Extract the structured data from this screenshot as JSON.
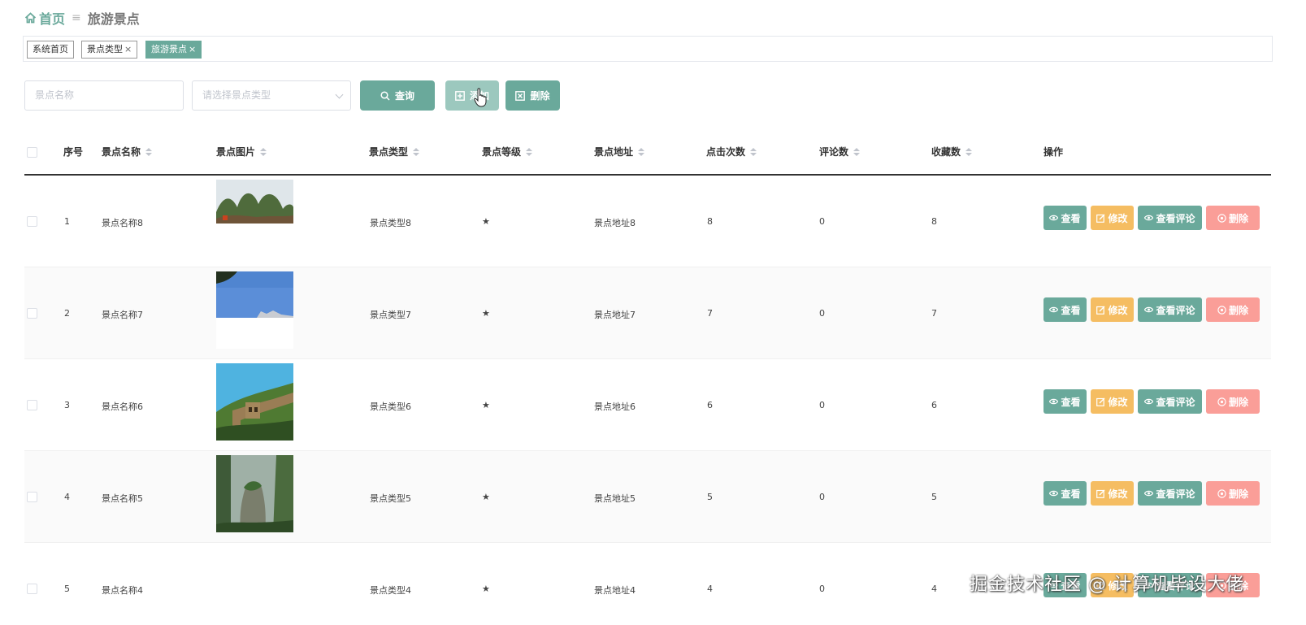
{
  "breadcrumb": {
    "home": "首页",
    "separator": "≡",
    "current": "旅游景点"
  },
  "tabs": [
    {
      "label": "系统首页",
      "closable": false,
      "active": false
    },
    {
      "label": "景点类型",
      "closable": true,
      "active": false
    },
    {
      "label": "旅游景点",
      "closable": true,
      "active": true
    }
  ],
  "search": {
    "name_placeholder": "景点名称",
    "type_placeholder": "请选择景点类型",
    "query_label": "查询",
    "add_label": "添加",
    "delete_label": "删除"
  },
  "table": {
    "columns": [
      "序号",
      "景点名称",
      "景点图片",
      "景点类型",
      "景点等级",
      "景点地址",
      "点击次数",
      "评论数",
      "收藏数",
      "操作"
    ],
    "rows": [
      {
        "index": "1",
        "name": "景点名称8",
        "image": "karst-mountains",
        "type": "景点类型8",
        "level": "★",
        "address": "景点地址8",
        "clicks": "8",
        "comments": "0",
        "favorites": "8"
      },
      {
        "index": "2",
        "name": "景点名称7",
        "image": "blue-sky",
        "type": "景点类型7",
        "level": "★",
        "address": "景点地址7",
        "clicks": "7",
        "comments": "0",
        "favorites": "7"
      },
      {
        "index": "3",
        "name": "景点名称6",
        "image": "great-wall",
        "type": "景点类型6",
        "level": "★",
        "address": "景点地址6",
        "clicks": "6",
        "comments": "0",
        "favorites": "6"
      },
      {
        "index": "4",
        "name": "景点名称5",
        "image": "stone-pillars",
        "type": "景点类型5",
        "level": "★",
        "address": "景点地址5",
        "clicks": "5",
        "comments": "0",
        "favorites": "5"
      },
      {
        "index": "5",
        "name": "景点名称4",
        "image": "none",
        "type": "景点类型4",
        "level": "★",
        "address": "景点地址4",
        "clicks": "4",
        "comments": "0",
        "favorites": "4"
      }
    ],
    "row_actions": {
      "view": "查看",
      "edit": "修改",
      "view_comments": "查看评论",
      "delete": "删除"
    }
  },
  "watermark": "掘金技术社区 @ 计算机毕设大佬",
  "colors": {
    "primary": "#6aa99b",
    "edit": "#f5bd62",
    "delete": "#fa9e98"
  }
}
